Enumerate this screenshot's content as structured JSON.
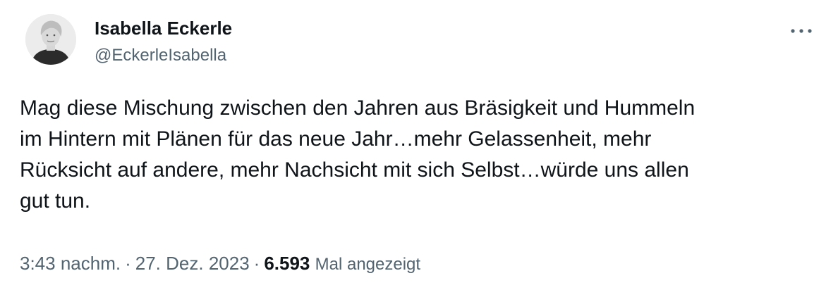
{
  "author": {
    "display_name": "Isabella Eckerle",
    "handle": "@EckerleIsabella",
    "avatar_icon": "profile-photo-icon"
  },
  "more_icon": "more-horizontal-icon",
  "tweet": {
    "lines": [
      "Mag diese Mischung zwischen den Jahren aus Bräsigkeit und Hummeln",
      "im Hintern mit Plänen für das neue Jahr…mehr Gelassenheit, mehr",
      "Rücksicht auf andere, mehr Nachsicht mit sich Selbst…würde uns allen",
      "gut tun."
    ]
  },
  "meta": {
    "time": "3:43 nachm.",
    "separator": "·",
    "date": "27. Dez. 2023",
    "views_count": "6.593",
    "views_label": "Mal angezeigt"
  },
  "colors": {
    "text_primary": "#0f1419",
    "text_secondary": "#536471",
    "background": "#ffffff"
  }
}
